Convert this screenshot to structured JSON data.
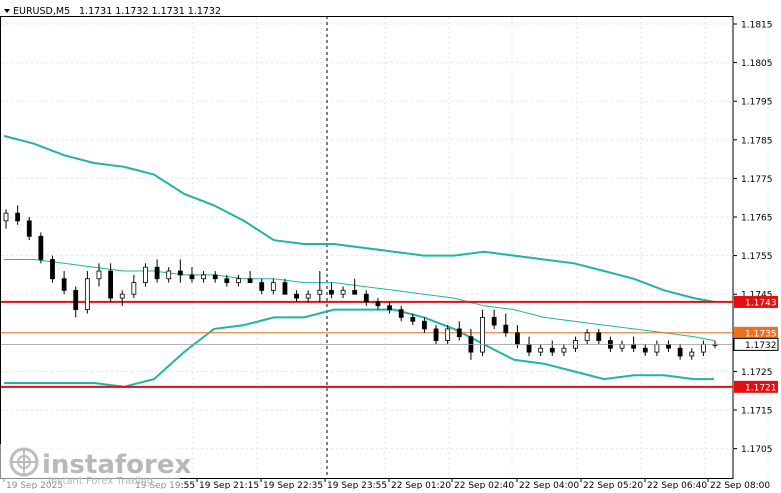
{
  "header": {
    "symbol": "EURUSD,M5",
    "ohlc": "1.1731 1.1732 1.1731 1.1732"
  },
  "chart_data": {
    "type": "candlestick",
    "symbol": "EURUSD",
    "timeframe": "M5",
    "ylim": [
      1.17,
      1.182
    ],
    "y_ticks": [
      "1.1815",
      "1.1805",
      "1.1795",
      "1.1785",
      "1.1775",
      "1.1765",
      "1.1755",
      "1.1745",
      "1.1735",
      "1.1725",
      "1.1715",
      "1.1705"
    ],
    "x_ticks": [
      "19 Sep 2025",
      "19 Sep 19:55",
      "19 Sep 21:15",
      "19 Sep 22:35",
      "19 Sep 23:55",
      "22 Sep 01:20",
      "22 Sep 02:40",
      "22 Sep 04:00",
      "22 Sep 05:20",
      "22 Sep 06:40",
      "22 Sep 08:00"
    ],
    "x_ticks_visible": [
      "19 Sep 2025",
      "19 Sep 19:55",
      "19 Sep 21:15",
      "19 Sep 22:35",
      "19 Sep 23:55",
      "22 Sep 01:20",
      "22 Sep 02:40",
      "22 Sep 04:00",
      "22 Sep 05:20",
      "22 Sep 06:40",
      "22 Sep 08:00"
    ],
    "current_price": "1.1732",
    "levels": [
      {
        "label": "1.1743",
        "value": 1.1743,
        "color": "#e01010"
      },
      {
        "label": "1.1735",
        "value": 1.1735,
        "color": "#f07020"
      },
      {
        "label": "1.1721",
        "value": 1.1721,
        "color": "#e01010"
      }
    ],
    "bollinger": {
      "upper": [
        [
          0,
          1.1786
        ],
        [
          3,
          1.1784
        ],
        [
          6,
          1.1781
        ],
        [
          9,
          1.1779
        ],
        [
          12,
          1.1778
        ],
        [
          15,
          1.1776
        ],
        [
          18,
          1.1771
        ],
        [
          21,
          1.1768
        ],
        [
          24,
          1.1764
        ],
        [
          27,
          1.1759
        ],
        [
          30,
          1.1758
        ],
        [
          33,
          1.1758
        ],
        [
          36,
          1.1757
        ],
        [
          39,
          1.1756
        ],
        [
          42,
          1.1755
        ],
        [
          45,
          1.1755
        ],
        [
          48,
          1.1756
        ],
        [
          51,
          1.1755
        ],
        [
          54,
          1.1754
        ],
        [
          57,
          1.1753
        ],
        [
          60,
          1.1751
        ],
        [
          63,
          1.1749
        ],
        [
          66,
          1.1746
        ],
        [
          69,
          1.1744
        ],
        [
          71,
          1.1743
        ]
      ],
      "middle": [
        [
          0,
          1.1754
        ],
        [
          3,
          1.1754
        ],
        [
          6,
          1.1753
        ],
        [
          9,
          1.1752
        ],
        [
          12,
          1.1751
        ],
        [
          15,
          1.1751
        ],
        [
          18,
          1.175
        ],
        [
          21,
          1.175
        ],
        [
          24,
          1.1749
        ],
        [
          27,
          1.1749
        ],
        [
          30,
          1.1748
        ],
        [
          33,
          1.1748
        ],
        [
          36,
          1.1747
        ],
        [
          39,
          1.1746
        ],
        [
          42,
          1.1745
        ],
        [
          45,
          1.1744
        ],
        [
          48,
          1.1742
        ],
        [
          51,
          1.1741
        ],
        [
          54,
          1.1739
        ],
        [
          57,
          1.1738
        ],
        [
          60,
          1.1737
        ],
        [
          63,
          1.1736
        ],
        [
          66,
          1.1735
        ],
        [
          69,
          1.1734
        ],
        [
          71,
          1.1733
        ]
      ],
      "lower": [
        [
          0,
          1.1722
        ],
        [
          3,
          1.1722
        ],
        [
          6,
          1.1722
        ],
        [
          9,
          1.1722
        ],
        [
          12,
          1.1721
        ],
        [
          15,
          1.1723
        ],
        [
          18,
          1.173
        ],
        [
          21,
          1.1736
        ],
        [
          24,
          1.1737
        ],
        [
          27,
          1.1739
        ],
        [
          30,
          1.1739
        ],
        [
          33,
          1.1741
        ],
        [
          36,
          1.1741
        ],
        [
          39,
          1.1741
        ],
        [
          42,
          1.1739
        ],
        [
          45,
          1.1736
        ],
        [
          48,
          1.1732
        ],
        [
          51,
          1.1728
        ],
        [
          54,
          1.1727
        ],
        [
          57,
          1.1725
        ],
        [
          60,
          1.1723
        ],
        [
          63,
          1.1724
        ],
        [
          66,
          1.1724
        ],
        [
          69,
          1.1723
        ],
        [
          71,
          1.1723
        ]
      ]
    },
    "candles": [
      [
        1.1764,
        1.1767,
        1.1762,
        1.1766
      ],
      [
        1.1766,
        1.1768,
        1.1763,
        1.1764
      ],
      [
        1.1764,
        1.1765,
        1.1759,
        1.176
      ],
      [
        1.176,
        1.1761,
        1.1753,
        1.1754
      ],
      [
        1.1754,
        1.1755,
        1.1748,
        1.1749
      ],
      [
        1.1749,
        1.1751,
        1.1745,
        1.1746
      ],
      [
        1.1746,
        1.1747,
        1.1739,
        1.1741
      ],
      [
        1.1741,
        1.1751,
        1.174,
        1.1749
      ],
      [
        1.1749,
        1.1753,
        1.1747,
        1.1751
      ],
      [
        1.1751,
        1.1753,
        1.1743,
        1.1744
      ],
      [
        1.1744,
        1.1746,
        1.1742,
        1.1745
      ],
      [
        1.1745,
        1.175,
        1.1744,
        1.1748
      ],
      [
        1.1748,
        1.1753,
        1.1747,
        1.1752
      ],
      [
        1.1752,
        1.1754,
        1.1748,
        1.1749
      ],
      [
        1.1749,
        1.1752,
        1.1748,
        1.1751
      ],
      [
        1.1751,
        1.1754,
        1.1748,
        1.175
      ],
      [
        1.175,
        1.1752,
        1.1748,
        1.1749
      ],
      [
        1.1749,
        1.1751,
        1.1748,
        1.175
      ],
      [
        1.175,
        1.1751,
        1.1748,
        1.1749
      ],
      [
        1.1749,
        1.175,
        1.1747,
        1.1748
      ],
      [
        1.1748,
        1.175,
        1.1747,
        1.1749
      ],
      [
        1.1749,
        1.1751,
        1.1748,
        1.1748
      ],
      [
        1.1748,
        1.1749,
        1.1745,
        1.1746
      ],
      [
        1.1746,
        1.1749,
        1.1745,
        1.1748
      ],
      [
        1.1748,
        1.1749,
        1.1745,
        1.1745
      ],
      [
        1.1745,
        1.1746,
        1.1743,
        1.1744
      ],
      [
        1.1744,
        1.1746,
        1.1743,
        1.1745
      ],
      [
        1.1745,
        1.1751,
        1.1743,
        1.1746
      ],
      [
        1.1746,
        1.1748,
        1.1744,
        1.1745
      ],
      [
        1.1745,
        1.1747,
        1.1744,
        1.1746
      ],
      [
        1.1746,
        1.1749,
        1.1745,
        1.1745
      ],
      [
        1.1745,
        1.1746,
        1.1742,
        1.1743
      ],
      [
        1.1743,
        1.1744,
        1.1741,
        1.1742
      ],
      [
        1.1742,
        1.1743,
        1.174,
        1.1741
      ],
      [
        1.1741,
        1.1742,
        1.1738,
        1.1739
      ],
      [
        1.1739,
        1.174,
        1.1737,
        1.1738
      ],
      [
        1.1738,
        1.1739,
        1.1735,
        1.1736
      ],
      [
        1.1736,
        1.1737,
        1.1732,
        1.1733
      ],
      [
        1.1733,
        1.1737,
        1.1732,
        1.1736
      ],
      [
        1.1736,
        1.1738,
        1.1733,
        1.1734
      ],
      [
        1.1734,
        1.1736,
        1.1728,
        1.173
      ],
      [
        1.173,
        1.1741,
        1.1729,
        1.1739
      ],
      [
        1.1739,
        1.1741,
        1.1736,
        1.1737
      ],
      [
        1.1737,
        1.174,
        1.1734,
        1.1735
      ],
      [
        1.1735,
        1.1737,
        1.1731,
        1.1732
      ],
      [
        1.1732,
        1.1734,
        1.1729,
        1.173
      ],
      [
        1.173,
        1.1732,
        1.1729,
        1.1731
      ],
      [
        1.1731,
        1.1733,
        1.1729,
        1.173
      ],
      [
        1.173,
        1.1732,
        1.1729,
        1.1731
      ],
      [
        1.1731,
        1.1734,
        1.173,
        1.1733
      ],
      [
        1.1733,
        1.1736,
        1.1732,
        1.1735
      ],
      [
        1.1735,
        1.1736,
        1.1732,
        1.1733
      ],
      [
        1.1733,
        1.1734,
        1.173,
        1.1731
      ],
      [
        1.1731,
        1.1733,
        1.173,
        1.1732
      ],
      [
        1.1732,
        1.1734,
        1.173,
        1.1731
      ],
      [
        1.1731,
        1.1732,
        1.1729,
        1.173
      ],
      [
        1.173,
        1.1733,
        1.1729,
        1.1732
      ],
      [
        1.1732,
        1.1733,
        1.173,
        1.1731
      ],
      [
        1.1731,
        1.1732,
        1.1728,
        1.1729
      ],
      [
        1.1729,
        1.1731,
        1.1728,
        1.173
      ],
      [
        1.173,
        1.1733,
        1.1729,
        1.1732
      ],
      [
        1.1732,
        1.1733,
        1.1731,
        1.1732
      ]
    ]
  },
  "watermark": {
    "brand": "instaforex",
    "tagline": "Instant Forex Trading"
  },
  "colors": {
    "bands": "#1fb4a6",
    "candle": "#000000",
    "grid": "#e2e2e2",
    "level_red": "#e01010",
    "level_orange": "#f07020"
  }
}
